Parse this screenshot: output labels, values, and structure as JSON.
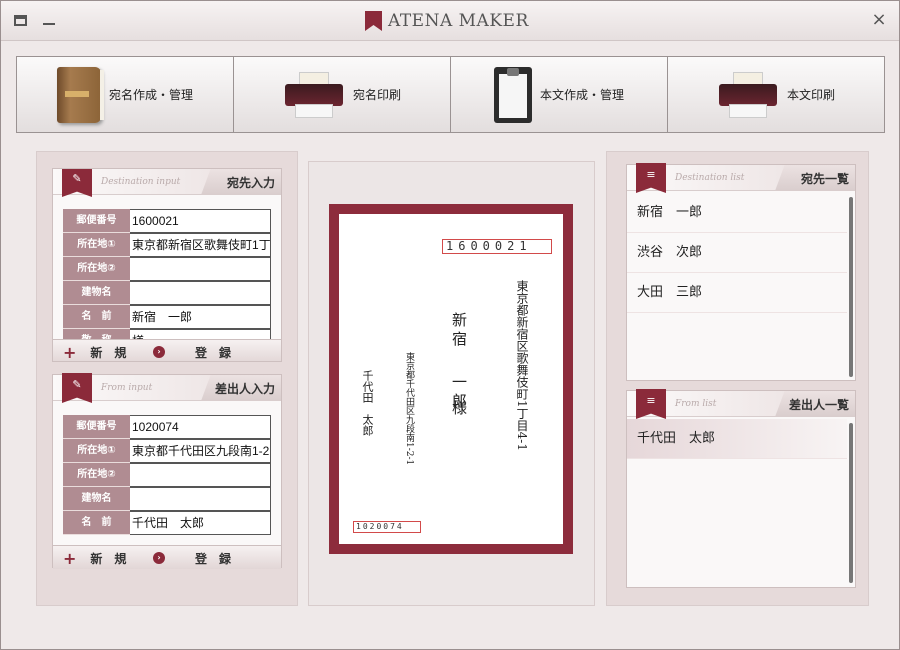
{
  "app": {
    "title": "ATENA MAKER"
  },
  "titlebar": {
    "close": "×"
  },
  "toolbar": {
    "buttons": [
      {
        "label": "宛名作成・管理",
        "icon": "address-book-icon"
      },
      {
        "label": "宛名印刷",
        "icon": "printer-icon"
      },
      {
        "label": "本文作成・管理",
        "icon": "clipboard-icon"
      },
      {
        "label": "本文印刷",
        "icon": "printer-icon"
      }
    ]
  },
  "destination_input": {
    "title": "宛先入力",
    "subtitle": "Destination input",
    "fields": [
      {
        "label": "郵便番号",
        "value": "1600021"
      },
      {
        "label": "所在地①",
        "value": "東京都新宿区歌舞伎町1丁"
      },
      {
        "label": "所在地②",
        "value": ""
      },
      {
        "label": "建物名",
        "value": ""
      },
      {
        "label": "名　前",
        "value": "新宿　一郎"
      },
      {
        "label": "敬　称",
        "value": "様"
      }
    ],
    "new_label": "新　規",
    "register_label": "登　録"
  },
  "from_input": {
    "title": "差出人入力",
    "subtitle": "From input",
    "fields": [
      {
        "label": "郵便番号",
        "value": "1020074"
      },
      {
        "label": "所在地①",
        "value": "東京都千代田区九段南1-2"
      },
      {
        "label": "所在地②",
        "value": ""
      },
      {
        "label": "建物名",
        "value": ""
      },
      {
        "label": "名　前",
        "value": "千代田　太郎"
      }
    ],
    "new_label": "新　規",
    "register_label": "登　録"
  },
  "preview": {
    "to_zip": "1600021",
    "to_address": "東京都新宿区歌舞伎町1丁目4-1",
    "to_name_family": "新宿",
    "to_name_given": "一郎",
    "to_honorific": "様",
    "from_address": "東京都千代田区九段南1-2-1",
    "from_name": "千代田　太郎",
    "from_zip": "1020074"
  },
  "destination_list": {
    "title": "宛先一覧",
    "subtitle": "Destination list",
    "items": [
      "新宿　一郎",
      "渋谷　次郎",
      "大田　三郎"
    ]
  },
  "from_list": {
    "title": "差出人一覧",
    "subtitle": "From list",
    "items": [
      "千代田　太郎"
    ]
  },
  "colors": {
    "accent": "#8b2a3a",
    "label_bg": "#b08c92",
    "envelope": "#8d2c3c"
  }
}
